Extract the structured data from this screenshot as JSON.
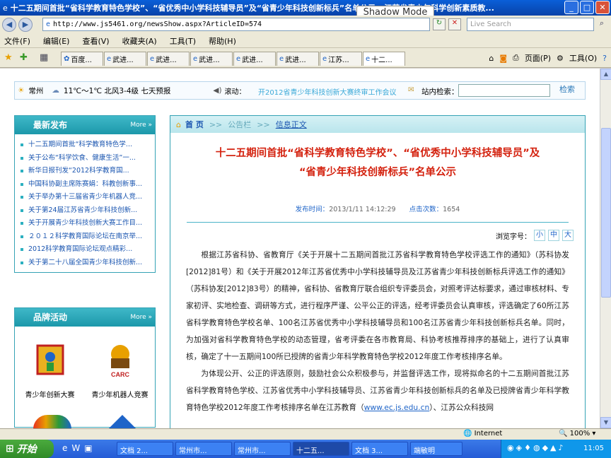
{
  "window": {
    "title": "十二五期间首批“省科学教育特色学校”、“省优秀中小学科技辅导员”及“省青少年科技创新标兵”名单公示 - 江苏省青少年科学创新素质教...",
    "min": "_",
    "max": "□",
    "close": "✕"
  },
  "overlay": {
    "shadow_mode": "Shadow Mode"
  },
  "address": {
    "url": "http://www.js5461.org/newsShow.aspx?ArticleID=574"
  },
  "live_search": {
    "placeholder": "Live Search"
  },
  "menu": [
    "文件(F)",
    "编辑(E)",
    "查看(V)",
    "收藏夹(A)",
    "工具(T)",
    "帮助(H)"
  ],
  "tabs": [
    "百度...",
    "武进...",
    "武进...",
    "武进...",
    "武进...",
    "武进...",
    "江苏...",
    "十二..."
  ],
  "toolbar_right": {
    "page": "页面(P)",
    "tools": "工具(O)"
  },
  "topstrip": {
    "city": "常州",
    "weather": "11℃～1℃  北风3-4级  七天预报",
    "scroll_label": "滚动：",
    "scroll_text": "开2012省青少年科技创新大赛终审工作会议",
    "site_search_label": "站内检索：",
    "search_button": "检索"
  },
  "latest": {
    "title": "最新发布",
    "more": "More",
    "items": [
      "十二五期间首批“科学教育特色学...",
      "关于公布“科学饮食、健康生活”一...",
      "新华日报刊发“2012科学教育国...",
      "中国科协副主席陈赛娟：科教创新事...",
      "关于举办第十三届省青少年机器人竞...",
      "关于第24届江苏省青少年科技创新...",
      "关于开展青少年科技创新大赛工作目...",
      "２０１２科学教育国际论坛在南京举...",
      "2012科学教育国际论坛观点精彩...",
      "关于第二十八届全国青少年科技创新..."
    ]
  },
  "brand": {
    "title": "品牌活动",
    "more": "More",
    "item1": "青少年创新大赛",
    "item2": "青少年机器人竞赛",
    "carc": "CARC"
  },
  "breadcrumb": {
    "home": "首 页",
    "sep1": ">>",
    "c2": "公告栏",
    "sep2": ">>",
    "c3": "信息正文"
  },
  "article": {
    "title_line1": "十二五期间首批“省科学教育特色学校”、“省优秀中小学科技辅导员”及",
    "title_line2": "“省青少年科技创新标兵”名单公示",
    "time_label": "发布时间：",
    "time": "2013/1/11 14:12:29",
    "clicks_label": "点击次数：",
    "clicks": "1654",
    "font_label": "浏览字号：",
    "font_small": "小",
    "font_mid": "中",
    "font_large": "大",
    "para1": "根据江苏省科协、省教育厅《关于开展十二五期间首批江苏省科学教育特色学校评选工作的通知》（苏科协发[2012]81号）和《关于开展2012年江苏省优秀中小学科技辅导员及江苏省青少年科技创新标兵评选工作的通知》（苏科协发[2012]83号）的精神，省科协、省教育厅联合组织专评委员会，对照考评达标要求，通过审核材料、专家初评、实地检查、调研等方式，进行程序严谨、公平公正的评选，经考评委员会认真审核，评选确定了60所江苏省科学教育特色学校名单、100名江苏省优秀中小学科技辅导员和100名江苏省青少年科技创新标兵名单。同时，为加强对省科学教育特色学校的动态管理，省考评委在各市教育局、科协考核推荐排序的基础上，进行了认真审核，确定了十一五期间100所已授牌的省青少年科学教育特色学校2012年度工作考核排序名单。",
    "para2_a": "为体现公开、公正的评选原则，鼓励社会公众积极参与，并监督评选工作，现将拟命名的十二五期间首批江苏省科学教育特色学校、江苏省优秀中小学科技辅导员、江苏省青少年科技创新标兵的名单及已授牌省青少年科学教育特色学校2012年度工作考核排序名单在江苏教育（",
    "para2_link": "www.ec.js.edu.cn",
    "para2_b": "）、江苏公众科技网"
  },
  "status": {
    "zone": "Internet",
    "zoom": "100%"
  },
  "taskbar": {
    "start": "开始",
    "tasks": [
      "文档 2...",
      "常州市...",
      "常州市...",
      "十二五...",
      "文档 3...",
      "端敏明"
    ],
    "clock": "11:05"
  }
}
